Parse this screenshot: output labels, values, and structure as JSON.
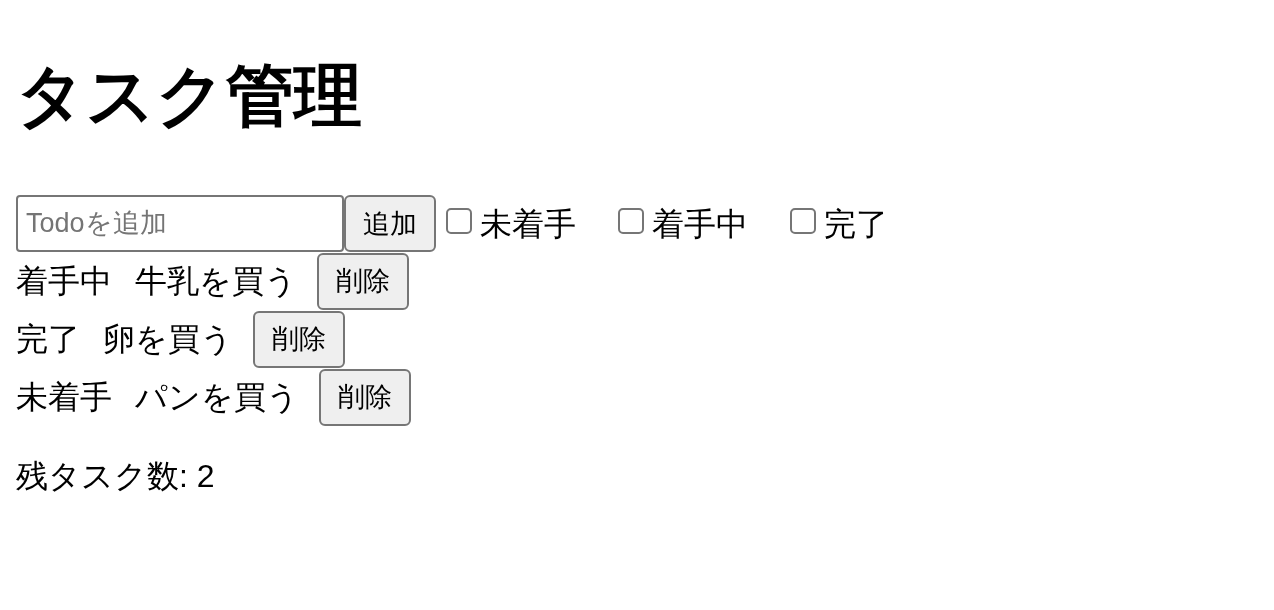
{
  "title": "タスク管理",
  "add_form": {
    "placeholder": "Todoを追加",
    "button": "追加"
  },
  "filters": [
    {
      "label": "未着手",
      "checked": false
    },
    {
      "label": "着手中",
      "checked": false
    },
    {
      "label": "完了",
      "checked": false
    }
  ],
  "todos": [
    {
      "status": "着手中",
      "title": "牛乳を買う",
      "delete_button": "削除"
    },
    {
      "status": "完了",
      "title": "卵を買う",
      "delete_button": "削除"
    },
    {
      "status": "未着手",
      "title": "パンを買う",
      "delete_button": "削除"
    }
  ],
  "remaining": "残タスク数: 2"
}
